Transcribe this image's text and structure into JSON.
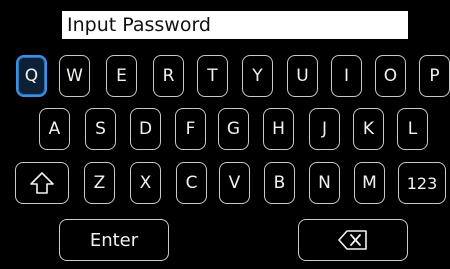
{
  "input": {
    "placeholder": "Input Password"
  },
  "keyboard": {
    "row1": [
      "Q",
      "W",
      "E",
      "R",
      "T",
      "Y",
      "U",
      "I",
      "O",
      "P"
    ],
    "row2": [
      "A",
      "S",
      "D",
      "F",
      "G",
      "H",
      "J",
      "K",
      "L"
    ],
    "row3": [
      "Z",
      "X",
      "C",
      "V",
      "B",
      "N",
      "M"
    ],
    "shift_icon": "shift-arrow-icon",
    "numbers_label": "123",
    "enter_label": "Enter",
    "backspace_icon": "backspace-icon",
    "selected_key": "Q"
  },
  "colors": {
    "background": "#000000",
    "key_border": "#c9c9c9",
    "key_text": "#f2f2f2",
    "selected_border": "#3d8fe0",
    "input_background": "#ffffff"
  }
}
